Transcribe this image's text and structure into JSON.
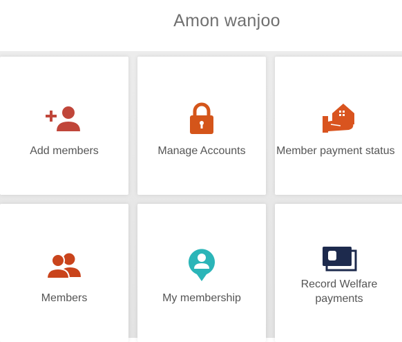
{
  "header": {
    "title": "Amon wanjoo"
  },
  "tiles": [
    {
      "label": "Add members",
      "icon": "add-user-icon",
      "color": "#c0463a"
    },
    {
      "label": "Manage Accounts",
      "icon": "lock-icon",
      "color": "#d4551a"
    },
    {
      "label": "Member payment status",
      "icon": "house-hand-icon",
      "color": "#d9541f"
    },
    {
      "label": "Members",
      "icon": "group-icon",
      "color": "#c9441c"
    },
    {
      "label": "My membership",
      "icon": "user-pin-icon",
      "color": "#2bb5b8"
    },
    {
      "label_line1": "Record Welfare",
      "label_line2": "payments",
      "icon": "banknote-icon",
      "color": "#1d2a4d"
    }
  ]
}
